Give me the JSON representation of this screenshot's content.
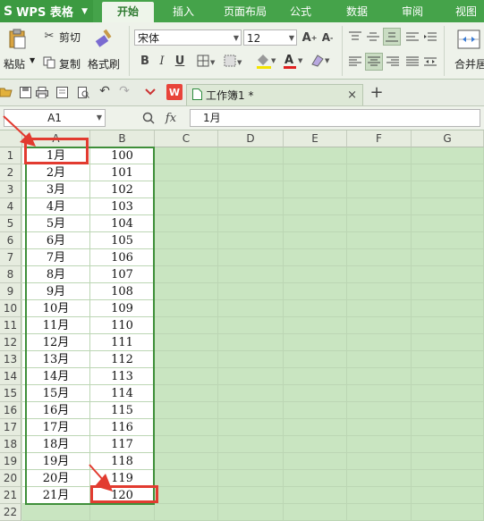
{
  "app": {
    "name": "WPS 表格",
    "logo": "S"
  },
  "ribbon_tabs": [
    "开始",
    "插入",
    "页面布局",
    "公式",
    "数据",
    "审阅",
    "视图"
  ],
  "active_tab": "开始",
  "clipboard": {
    "paste": "粘贴",
    "cut": "剪切",
    "copy": "复制",
    "format_painter": "格式刷"
  },
  "font": {
    "family": "宋体",
    "size": "12",
    "bold": "B",
    "italic": "I",
    "underline": "U"
  },
  "merge_label": "合并居",
  "document_tab": {
    "title": "工作簿1 *",
    "close": "×",
    "add": "+"
  },
  "formula_bar": {
    "name_box": "A1",
    "fx": "fx",
    "content": "1月"
  },
  "columns": [
    "A",
    "B",
    "C",
    "D",
    "E",
    "F",
    "G"
  ],
  "rows": [
    {
      "n": "1",
      "a": "1月",
      "b": "100"
    },
    {
      "n": "2",
      "a": "2月",
      "b": "101"
    },
    {
      "n": "3",
      "a": "3月",
      "b": "102"
    },
    {
      "n": "4",
      "a": "4月",
      "b": "103"
    },
    {
      "n": "5",
      "a": "5月",
      "b": "104"
    },
    {
      "n": "6",
      "a": "6月",
      "b": "105"
    },
    {
      "n": "7",
      "a": "7月",
      "b": "106"
    },
    {
      "n": "8",
      "a": "8月",
      "b": "107"
    },
    {
      "n": "9",
      "a": "9月",
      "b": "108"
    },
    {
      "n": "10",
      "a": "10月",
      "b": "109"
    },
    {
      "n": "11",
      "a": "11月",
      "b": "110"
    },
    {
      "n": "12",
      "a": "12月",
      "b": "111"
    },
    {
      "n": "13",
      "a": "13月",
      "b": "112"
    },
    {
      "n": "14",
      "a": "14月",
      "b": "113"
    },
    {
      "n": "15",
      "a": "15月",
      "b": "114"
    },
    {
      "n": "16",
      "a": "16月",
      "b": "115"
    },
    {
      "n": "17",
      "a": "17月",
      "b": "116"
    },
    {
      "n": "18",
      "a": "18月",
      "b": "117"
    },
    {
      "n": "19",
      "a": "19月",
      "b": "118"
    },
    {
      "n": "20",
      "a": "20月",
      "b": "119"
    },
    {
      "n": "21",
      "a": "21月",
      "b": "120"
    },
    {
      "n": "22",
      "a": "",
      "b": ""
    }
  ],
  "colors": {
    "ribbon_green": "#45a34a",
    "selection_border": "#3f8f3a",
    "annotation_red": "#e23b30",
    "sheet_bg": "#c9e5c1"
  },
  "icons": [
    "paste-icon",
    "cut-icon",
    "copy-icon",
    "format-painter-icon",
    "font-grow-icon",
    "font-shrink-icon",
    "borders-icon",
    "fill-color-icon",
    "font-color-icon",
    "align-icons",
    "merge-center-icon",
    "open-icon",
    "save-icon",
    "print-icon",
    "preview-icon",
    "undo-icon",
    "redo-icon",
    "wps-icon",
    "close-icon",
    "add-tab-icon",
    "zoom-icon",
    "fx-icon",
    "red-arrow-icon"
  ]
}
